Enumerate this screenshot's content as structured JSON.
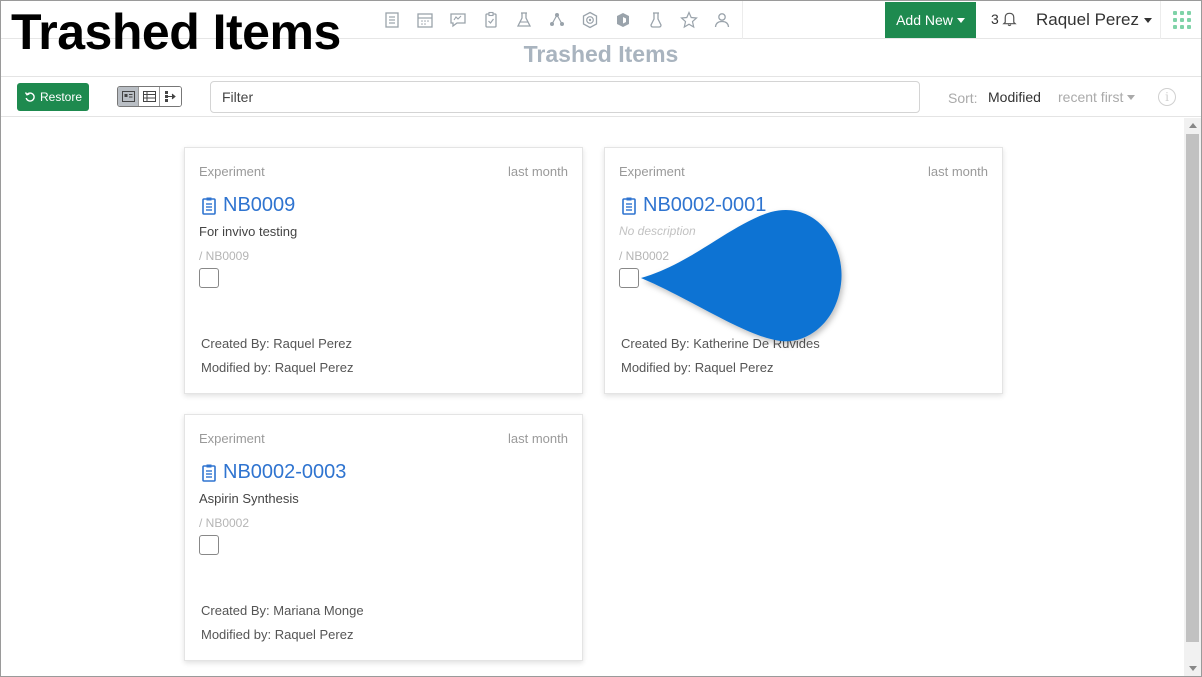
{
  "overlay": {
    "title": "Trashed Items"
  },
  "navbar": {
    "icons": [
      "notebook-icon",
      "calendar-icon",
      "chat-icon",
      "clipboard-icon",
      "lab-icon",
      "molecule-icon",
      "target-icon",
      "cube-icon",
      "flask-icon",
      "star-icon",
      "users-icon"
    ],
    "add_new_label": "Add New",
    "notification_count": "3",
    "user_name": "Raquel Perez"
  },
  "page": {
    "title": "Trashed Items"
  },
  "toolbar": {
    "restore_label": "Restore",
    "filter_placeholder": "Filter",
    "sort_label": "Sort:",
    "sort_field": "Modified",
    "sort_order": "recent first"
  },
  "cards": [
    {
      "type": "Experiment",
      "date": "last month",
      "title": "NB0009",
      "description": "For invivo testing",
      "path": "/ NB0009",
      "created_by": "Created By: Raquel Perez",
      "modified_by": "Modified by: Raquel Perez"
    },
    {
      "type": "Experiment",
      "date": "last month",
      "title": "NB0002-0001",
      "description": "No description",
      "path": "/ NB0002",
      "created_by": "Created By: Katherine De Ruvides",
      "modified_by": "Modified by: Raquel Perez"
    },
    {
      "type": "Experiment",
      "date": "last month",
      "title": "NB0002-0003",
      "description": "Aspirin Synthesis",
      "path": "/ NB0002",
      "created_by": "Created By: Mariana Monge",
      "modified_by": "Modified by: Raquel Perez"
    }
  ],
  "colors": {
    "primary_green": "#1e8a4f",
    "link_blue": "#2f74d0",
    "pointer_blue": "#0c73d3"
  }
}
